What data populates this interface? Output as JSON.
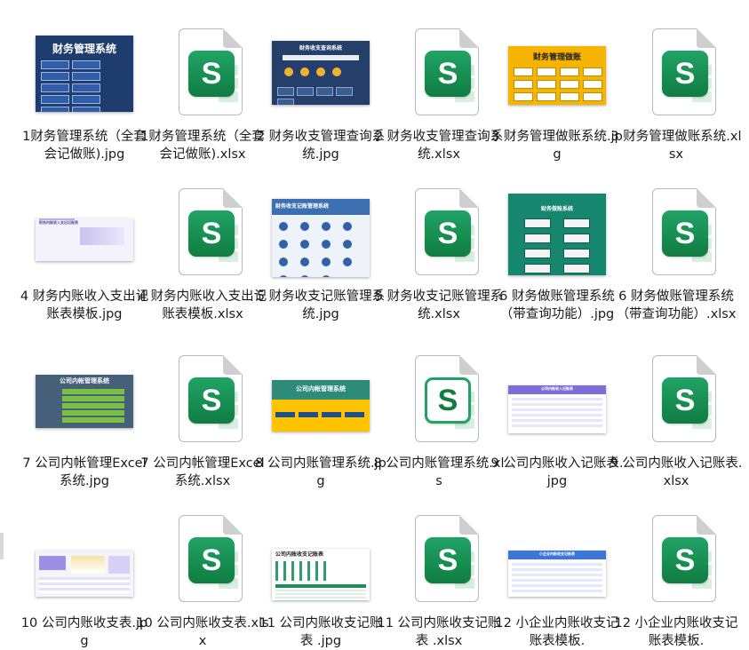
{
  "files": [
    {
      "name": "1财务管理系统（全套会记做账).jpg",
      "type": "jpg",
      "thumb": {
        "title": "财务管理系统",
        "theme": "navy"
      }
    },
    {
      "name": "1财务管理系统（全套会记做账).xlsx",
      "type": "xlsx",
      "icon": "excel-file-icon"
    },
    {
      "name": "2 财务收支管理查询系统.jpg",
      "type": "jpg",
      "thumb": {
        "title": "财务收支查询系统",
        "theme": "darkblue"
      }
    },
    {
      "name": "2 财务收支管理查询系统.xlsx",
      "type": "xlsx",
      "icon": "excel-file-icon"
    },
    {
      "name": "3 财务管理做账系统.jpg",
      "type": "jpg",
      "thumb": {
        "title": "财务管理做账",
        "theme": "yellow"
      }
    },
    {
      "name": "3 财务管理做账系统.xlsx",
      "type": "xlsx",
      "icon": "excel-file-icon"
    },
    {
      "name": "4 财务内账收入支出记账表模板.jpg",
      "type": "jpg",
      "thumb": {
        "title": "财务内账收入支出记账表",
        "theme": "light"
      }
    },
    {
      "name": "4 财务内账收入支出记账表模板.xlsx",
      "type": "xlsx",
      "icon": "excel-file-icon"
    },
    {
      "name": "5 财务收支记账管理系统.jpg",
      "type": "jpg",
      "thumb": {
        "title": "财务收支记账管理系统",
        "theme": "bluewhite"
      }
    },
    {
      "name": "5 财务收支记账管理系统.xlsx",
      "type": "xlsx",
      "icon": "excel-file-icon"
    },
    {
      "name": "6 财务做账管理系统（带查询功能）.jpg",
      "type": "jpg",
      "thumb": {
        "title": "财务做账系统",
        "theme": "teal"
      }
    },
    {
      "name": "6 财务做账管理系统（带查询功能）.xlsx",
      "type": "xlsx",
      "icon": "excel-file-icon"
    },
    {
      "name": "7 公司内帐管理Excel系统.jpg",
      "type": "jpg",
      "thumb": {
        "title": "公司内帐管理系统",
        "theme": "slate"
      }
    },
    {
      "name": "7 公司内帐管理Excel系统.xlsx",
      "type": "xlsx",
      "icon": "excel-file-icon"
    },
    {
      "name": "8 公司内账管理系统.jpg",
      "type": "jpg",
      "thumb": {
        "title": "公司内帐管理系统",
        "theme": "greenyellow"
      }
    },
    {
      "name": "8 公司内账管理系统.xls",
      "type": "xls",
      "icon": "excel-legacy-file-icon"
    },
    {
      "name": "9 公司内账收入记账表.jpg",
      "type": "jpg",
      "thumb": {
        "title": "公司内账收入记账表",
        "theme": "purpletable"
      }
    },
    {
      "name": "9 公司内账收入记账表.xlsx",
      "type": "xlsx",
      "icon": "excel-file-icon"
    },
    {
      "name": "10 公司内账收支表.jpg",
      "type": "jpg",
      "thumb": {
        "title": "",
        "theme": "dashboard"
      }
    },
    {
      "name": "10 公司内账收支表.xlsx",
      "type": "xlsx",
      "icon": "excel-file-icon"
    },
    {
      "name": "11 公司内账收支记账表 .jpg",
      "type": "jpg",
      "thumb": {
        "title": "公司内账收支记账表",
        "theme": "whitetable"
      }
    },
    {
      "name": "11 公司内账收支记账表 .xlsx",
      "type": "xlsx",
      "icon": "excel-file-icon"
    },
    {
      "name": "12 小企业内账收支记账表模板.",
      "type": "jpg",
      "thumb": {
        "title": "小企业内账收支记账表",
        "theme": "bluetable"
      }
    },
    {
      "name": "12 小企业内账收支记账表模板.",
      "type": "xlsx",
      "icon": "excel-file-icon"
    }
  ],
  "excel_letter": "S",
  "colors": {
    "excel_green": "#107c41",
    "excel_green_light": "#21a366",
    "label": "#1a1a1a"
  }
}
